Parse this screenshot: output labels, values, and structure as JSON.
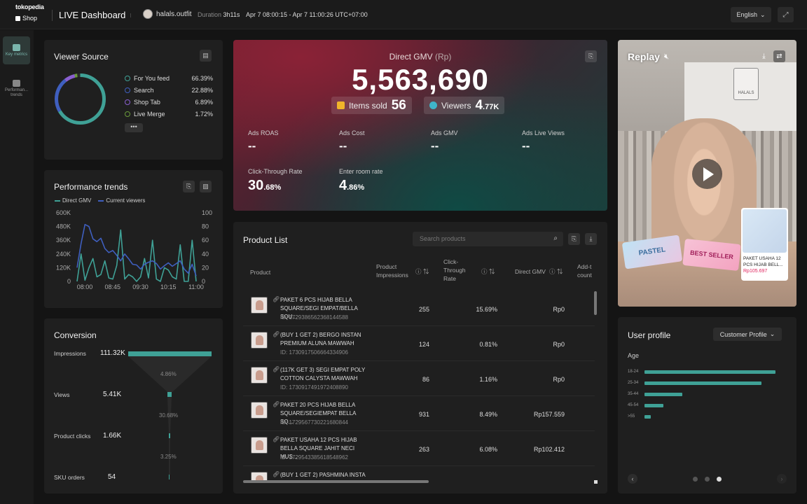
{
  "header": {
    "brand_top": "tokopedia",
    "brand_bottom": "Shop",
    "title": "LIVE Dashboard",
    "shop_name": "halals.outfit",
    "duration_label": "Duration",
    "duration_value": "3h11s",
    "time_range": "Apr 7 08:00:15 - Apr 7 11:00:26 UTC+07:00",
    "language": "English"
  },
  "sidebar": {
    "items": [
      {
        "label": "Key metrics",
        "icon": "home-icon"
      },
      {
        "label": "Performan... trends",
        "icon": "chart-icon"
      }
    ]
  },
  "viewer_source": {
    "title": "Viewer Source",
    "items": [
      {
        "name": "For You feed",
        "value": "66.39%",
        "color": "#3fa196"
      },
      {
        "name": "Search",
        "value": "22.88%",
        "color": "#3f5fbf"
      },
      {
        "name": "Shop Tab",
        "value": "6.89%",
        "color": "#8a5fd0"
      },
      {
        "name": "Live Merge",
        "value": "1.72%",
        "color": "#6a9a3a"
      }
    ],
    "more": "•••"
  },
  "hero": {
    "gmv_label": "Direct GMV",
    "gmv_unit": "(Rp)",
    "gmv_value": "5,563,690",
    "items_sold_label": "Items sold",
    "items_sold_value": "56",
    "viewers_label": "Viewers",
    "viewers_value": "4",
    "viewers_suffix": ".77K",
    "metrics": [
      {
        "label": "Ads ROAS",
        "value": "--"
      },
      {
        "label": "Ads Cost",
        "value": "--"
      },
      {
        "label": "Ads GMV",
        "value": "--"
      },
      {
        "label": "Ads Live Views",
        "value": "--"
      }
    ],
    "ctr_label": "Click-Through Rate",
    "ctr_value": "30",
    "ctr_suffix": ".68%",
    "enter_label": "Enter room rate",
    "enter_value": "4",
    "enter_suffix": ".86%"
  },
  "replay": {
    "title": "Replay",
    "store_sign": "HALALS",
    "tag1": "PASTEL",
    "tag2": "BEST SELLER",
    "product_name": "PAKET USAHA 12 PCS HIJAB BELL...",
    "product_price": "Rp105.697"
  },
  "performance": {
    "title": "Performance trends",
    "legend_gmv": "Direct GMV",
    "legend_viewers": "Current viewers"
  },
  "chart_data": {
    "type": "line",
    "x": [
      "08:00",
      "08:45",
      "09:30",
      "10:15",
      "11:00"
    ],
    "yleft_ticks": [
      "600K",
      "480K",
      "360K",
      "240K",
      "120K",
      "0"
    ],
    "yright_ticks": [
      "100",
      "80",
      "60",
      "40",
      "20",
      "0"
    ],
    "ylim_left": [
      0,
      600000
    ],
    "ylim_right": [
      0,
      100
    ],
    "series": [
      {
        "name": "Direct GMV",
        "axis": "left",
        "color": "#3fa196",
        "values": [
          0,
          240000,
          10000,
          120000,
          200000,
          40000,
          60000,
          180000,
          30000,
          20000,
          140000,
          450000,
          20000,
          60000,
          40000,
          0,
          40000,
          200000,
          30000,
          360000,
          20000,
          0,
          120000,
          100000,
          40000,
          20000,
          320000,
          0,
          0,
          360000,
          0
        ]
      },
      {
        "name": "Current viewers",
        "axis": "right",
        "color": "#3f5fbf",
        "values": [
          20,
          55,
          83,
          80,
          62,
          58,
          63,
          48,
          42,
          45,
          38,
          30,
          40,
          33,
          25,
          24,
          18,
          25,
          28,
          30,
          26,
          18,
          23,
          27,
          22,
          26,
          30,
          18,
          12,
          25,
          8
        ]
      }
    ]
  },
  "conversion": {
    "title": "Conversion",
    "stages": [
      {
        "label": "Impressions",
        "value": "111.32K"
      },
      {
        "label": "Views",
        "value": "5.41K"
      },
      {
        "label": "Product clicks",
        "value": "1.66K"
      },
      {
        "label": "SKU orders",
        "value": "54"
      }
    ],
    "rates": [
      "4.86%",
      "30.68%",
      "3.25%"
    ]
  },
  "product_list": {
    "title": "Product List",
    "search_placeholder": "Search products",
    "columns": [
      "Product",
      "Product Impressions",
      "Click-Through Rate",
      "Direct GMV",
      "Add-t count"
    ],
    "rows": [
      {
        "name": "PAKET 6 PCS HIJAB BELLA SQUARE/SEGI EMPAT/BELLA SQU...",
        "id": "ID: 1729386562368144588",
        "impressions": "255",
        "ctr": "15.69%",
        "gmv": "Rp0"
      },
      {
        "name": "(BUY 1 GET 2) BERGO INSTAN PREMIUM ALUNA MAWWAH",
        "id": "ID: 1730917506664334906",
        "impressions": "124",
        "ctr": "0.81%",
        "gmv": "Rp0"
      },
      {
        "name": "(117K GET 3) SEGI EMPAT POLY COTTON CALYSTA MAWWAH",
        "id": "ID: 1730917491972408890",
        "impressions": "86",
        "ctr": "1.16%",
        "gmv": "Rp0"
      },
      {
        "name": "PAKET 20 PCS HIJAB BELLA SQUARE/SEGIEMPAT BELLA SQ...",
        "id": "ID: 1729567730221680844",
        "impressions": "931",
        "ctr": "8.49%",
        "gmv": "Rp157.559"
      },
      {
        "name": "PAKET USAHA 12 PCS HIJAB BELLA SQUARE JAHIT NECI MUS...",
        "id": "ID: 1729543385618548962",
        "impressions": "263",
        "ctr": "6.08%",
        "gmv": "Rp102.412"
      },
      {
        "name": "(BUY 1 GET 2) PASHMINA INSTA",
        "id": "",
        "impressions": "",
        "ctr": "",
        "gmv": ""
      }
    ]
  },
  "user_profile": {
    "title": "User profile",
    "dropdown": "Customer Profile",
    "subtitle": "Age",
    "ages": [
      {
        "label": "18-24",
        "value": 0.83
      },
      {
        "label": "25-34",
        "value": 0.74
      },
      {
        "label": "35-44",
        "value": 0.24
      },
      {
        "label": "45-54",
        "value": 0.12
      },
      {
        "label": ">55",
        "value": 0.04
      }
    ]
  }
}
